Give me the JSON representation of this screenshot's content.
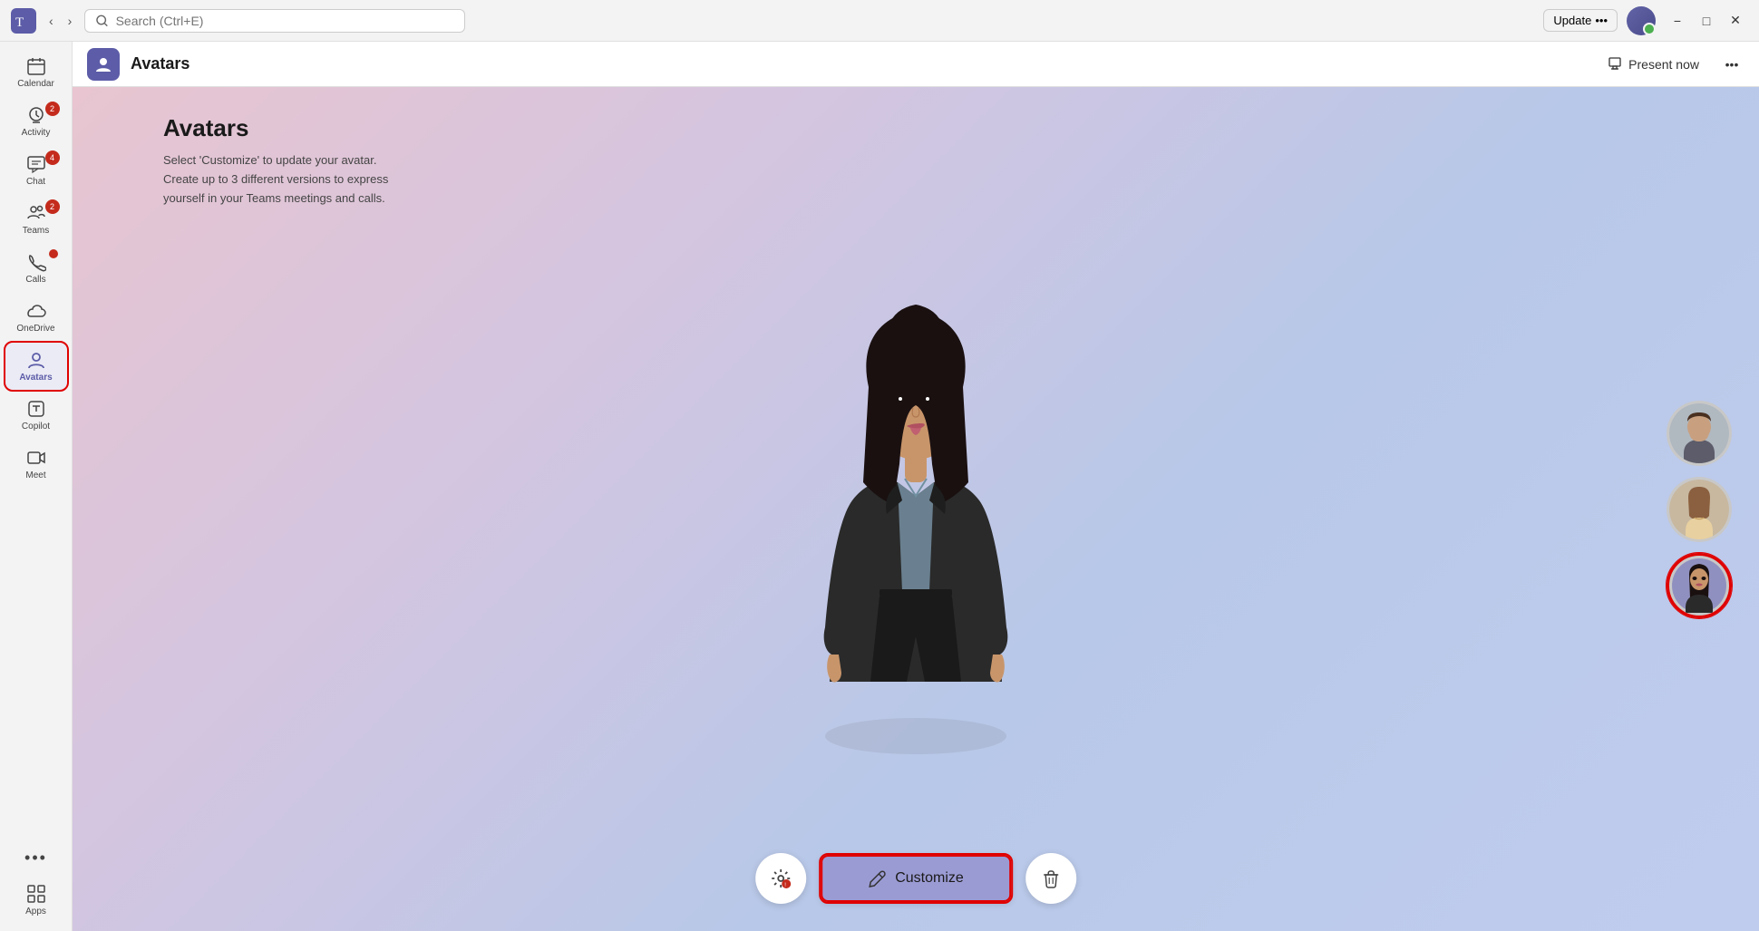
{
  "titlebar": {
    "search_placeholder": "Search (Ctrl+E)",
    "update_label": "Update",
    "update_more": "•••",
    "minimize": "−",
    "maximize": "□",
    "close": "✕"
  },
  "sidebar": {
    "items": [
      {
        "id": "calendar",
        "label": "Calendar",
        "icon": "📅",
        "badge": null,
        "active": false
      },
      {
        "id": "activity",
        "label": "Activity",
        "icon": "🔔",
        "badge": "2",
        "active": false
      },
      {
        "id": "chat",
        "label": "Chat",
        "icon": "💬",
        "badge": "4",
        "active": false
      },
      {
        "id": "teams",
        "label": "Teams",
        "icon": "👥",
        "badge": "2",
        "active": false
      },
      {
        "id": "calls",
        "label": "Calls",
        "icon": "📞",
        "badge_dot": true,
        "active": false
      },
      {
        "id": "onedrive",
        "label": "OneDrive",
        "icon": "☁️",
        "badge": null,
        "active": false
      },
      {
        "id": "avatars",
        "label": "Avatars",
        "icon": "🧑",
        "badge": null,
        "active": true
      },
      {
        "id": "copilot",
        "label": "Copilot",
        "icon": "⧉",
        "badge": null,
        "active": false
      },
      {
        "id": "meet",
        "label": "Meet",
        "icon": "🎥",
        "badge": null,
        "active": false
      }
    ],
    "more_label": "•••",
    "apps_label": "Apps",
    "apps_icon": "+"
  },
  "app_header": {
    "title": "Avatars",
    "present_label": "Present now",
    "more": "•••"
  },
  "content": {
    "title": "Avatars",
    "description_line1": "Select 'Customize' to update your avatar.",
    "description_line2": "Create up to 3 different versions to express",
    "description_line3": "yourself in your Teams meetings and calls."
  },
  "bottom_controls": {
    "customize_label": "Customize",
    "settings_icon": "⚙",
    "delete_icon": "🗑"
  },
  "colors": {
    "accent": "#5c5ca8",
    "active_nav": "#ebebf5",
    "badge_red": "#c42b1c",
    "customize_bg": "#9b9bd4",
    "highlight_red": "#e00000"
  }
}
